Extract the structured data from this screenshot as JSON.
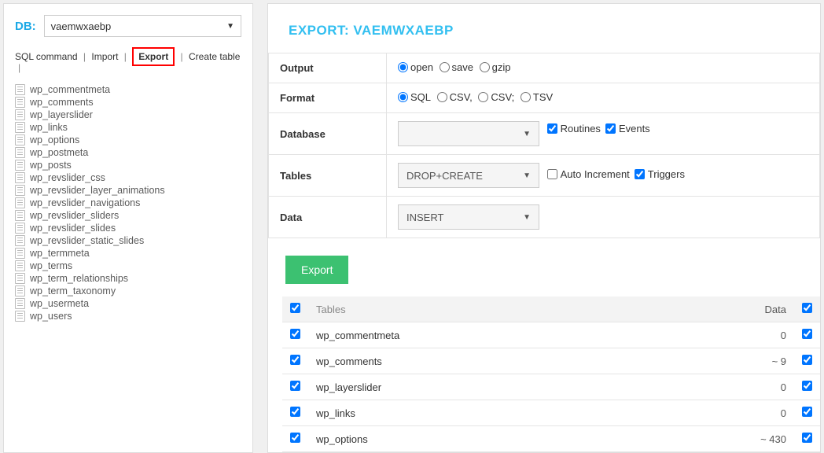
{
  "db": {
    "label": "DB:",
    "selected": "vaemwxaebp"
  },
  "nav": [
    "SQL command",
    "Import",
    "Export",
    "Create table"
  ],
  "nav_active": "Export",
  "tables": [
    "wp_commentmeta",
    "wp_comments",
    "wp_layerslider",
    "wp_links",
    "wp_options",
    "wp_postmeta",
    "wp_posts",
    "wp_revslider_css",
    "wp_revslider_layer_animations",
    "wp_revslider_navigations",
    "wp_revslider_sliders",
    "wp_revslider_slides",
    "wp_revslider_static_slides",
    "wp_termmeta",
    "wp_terms",
    "wp_term_relationships",
    "wp_term_taxonomy",
    "wp_usermeta",
    "wp_users"
  ],
  "main": {
    "title": "EXPORT: VAEMWXAEBP",
    "rows": {
      "output": {
        "label": "Output",
        "options": [
          "open",
          "save",
          "gzip"
        ],
        "selected": "open"
      },
      "format": {
        "label": "Format",
        "options": [
          "SQL",
          "CSV,",
          "CSV;",
          "TSV"
        ],
        "selected": "SQL"
      },
      "database": {
        "label": "Database",
        "select": "",
        "checks": [
          {
            "label": "Routines",
            "checked": true
          },
          {
            "label": "Events",
            "checked": true
          }
        ]
      },
      "tables_cfg": {
        "label": "Tables",
        "select": "DROP+CREATE",
        "checks": [
          {
            "label": "Auto Increment",
            "checked": false
          },
          {
            "label": "Triggers",
            "checked": true
          }
        ]
      },
      "data": {
        "label": "Data",
        "select": "INSERT"
      }
    },
    "export_btn": "Export",
    "grid": {
      "head_tables": "Tables",
      "head_data": "Data",
      "rows": [
        {
          "name": "wp_commentmeta",
          "data": "0"
        },
        {
          "name": "wp_comments",
          "data": "~ 9"
        },
        {
          "name": "wp_layerslider",
          "data": "0"
        },
        {
          "name": "wp_links",
          "data": "0"
        },
        {
          "name": "wp_options",
          "data": "~ 430"
        }
      ]
    }
  }
}
